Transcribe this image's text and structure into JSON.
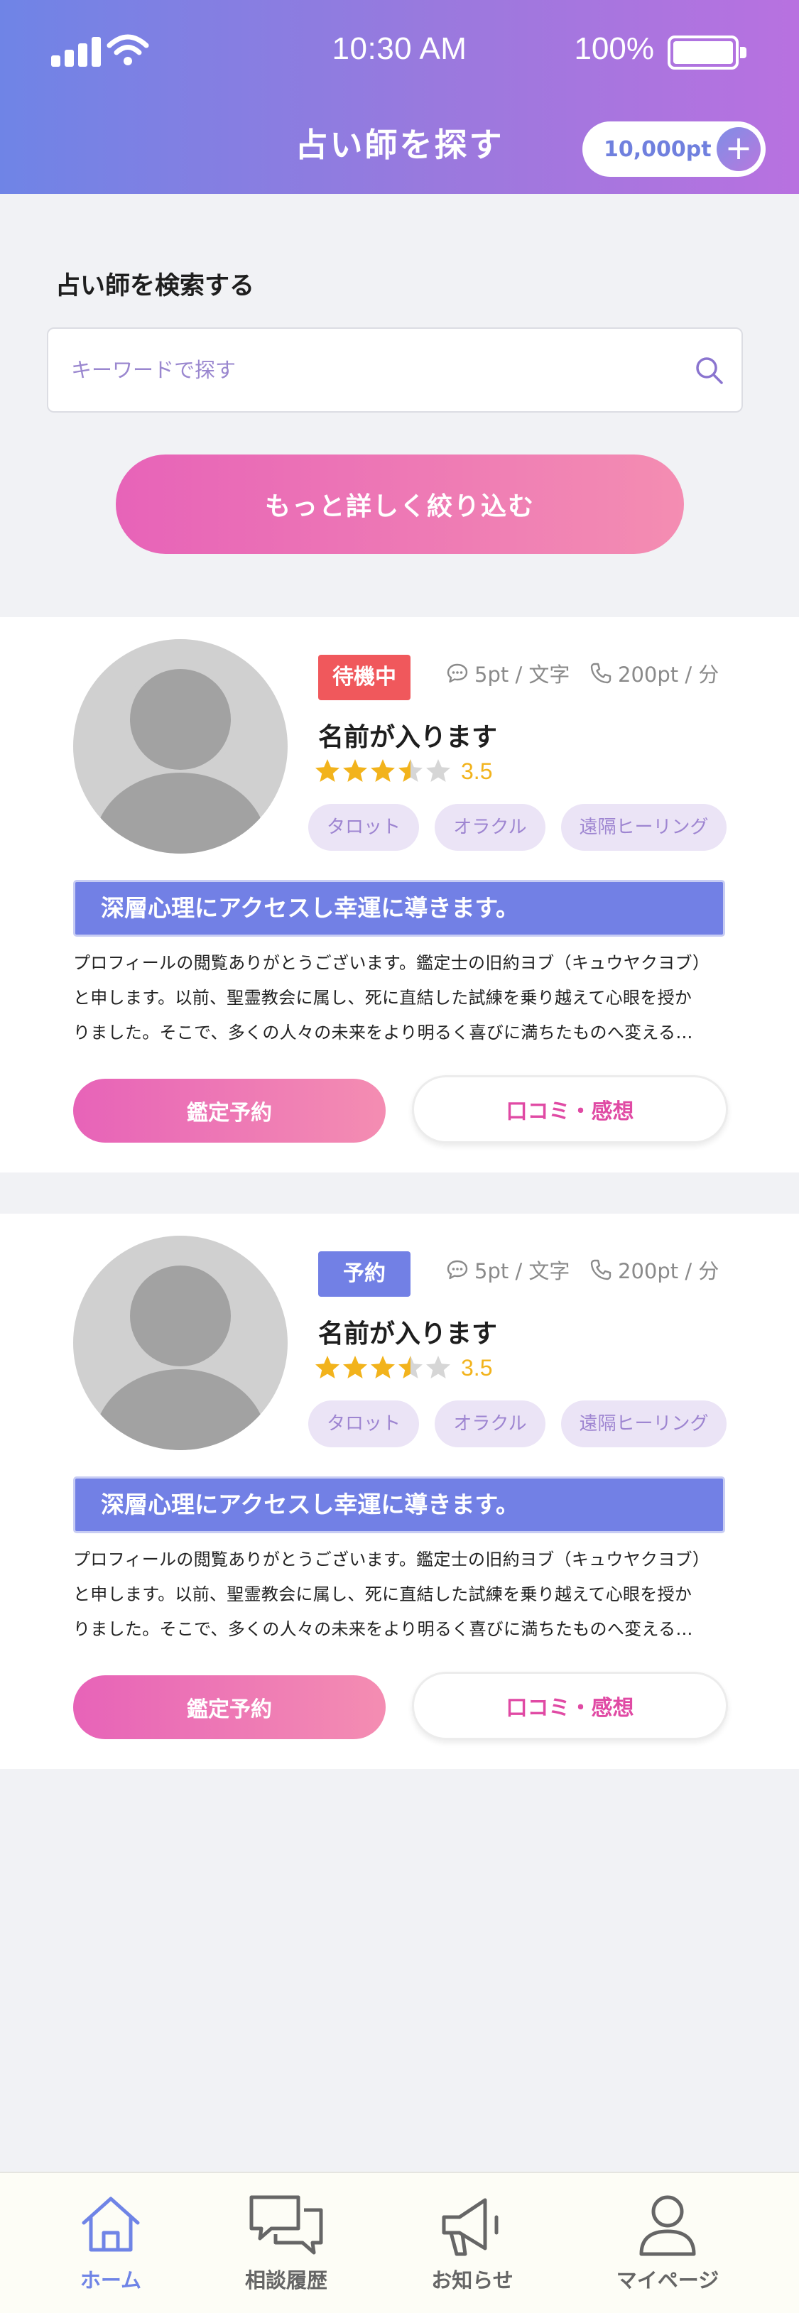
{
  "status_bar": {
    "time": "10:30 AM",
    "battery": "100%"
  },
  "header": {
    "title": "占い師を探す",
    "points": "10,000pt",
    "add_points_symbol": "+"
  },
  "search": {
    "heading": "占い師を検索する",
    "placeholder": "キーワードで探す",
    "refine_button": "もっと詳しく絞り込む"
  },
  "fortune_tellers": [
    {
      "status": "待機中",
      "status_color": "#f0585c",
      "chat_rate": "5pt / 文字",
      "call_rate": "200pt / 分",
      "name": "名前が入ります",
      "rating": 3.5,
      "rating_text": "3.5",
      "tags": [
        "タロット",
        "オラクル",
        "遠隔ヒーリング"
      ],
      "catchcopy": "深層心理にアクセスし幸運に導きます。",
      "profile_lines": [
        "プロフィールの閲覧ありがとうございます。鑑定士の旧約ヨブ（キュウヤクヨブ）",
        "と申します。以前、聖霊教会に属し、死に直結した試練を乗り越えて心眼を授か",
        "りました。そこで、多くの人々の未来をより明るく喜びに満ちたものへ変える…"
      ],
      "reserve_button": "鑑定予約",
      "review_button": "口コミ・感想"
    },
    {
      "status": "予約",
      "status_color": "#7280e5",
      "chat_rate": "5pt / 文字",
      "call_rate": "200pt / 分",
      "name": "名前が入ります",
      "rating": 3.5,
      "rating_text": "3.5",
      "tags": [
        "タロット",
        "オラクル",
        "遠隔ヒーリング"
      ],
      "catchcopy": "深層心理にアクセスし幸運に導きます。",
      "profile_lines": [
        "プロフィールの閲覧ありがとうございます。鑑定士の旧約ヨブ（キュウヤクヨブ）",
        "と申します。以前、聖霊教会に属し、死に直結した試練を乗り越えて心眼を授か",
        "りました。そこで、多くの人々の未来をより明るく喜びに満ちたものへ変える…"
      ],
      "reserve_button": "鑑定予約",
      "review_button": "口コミ・感想"
    }
  ],
  "bottom_nav": [
    {
      "label": "ホーム",
      "icon": "home-icon",
      "active": true
    },
    {
      "label": "相談履歴",
      "icon": "chat-bubbles-icon",
      "active": false
    },
    {
      "label": "お知らせ",
      "icon": "megaphone-icon",
      "active": false
    },
    {
      "label": "マイページ",
      "icon": "person-icon",
      "active": false
    }
  ],
  "colors": {
    "accent_blue": "#6f84e6",
    "accent_purple": "#b871e0",
    "accent_pink": "#e763b8",
    "star": "#f2b31c",
    "tag_bg": "#ebe4f6"
  }
}
